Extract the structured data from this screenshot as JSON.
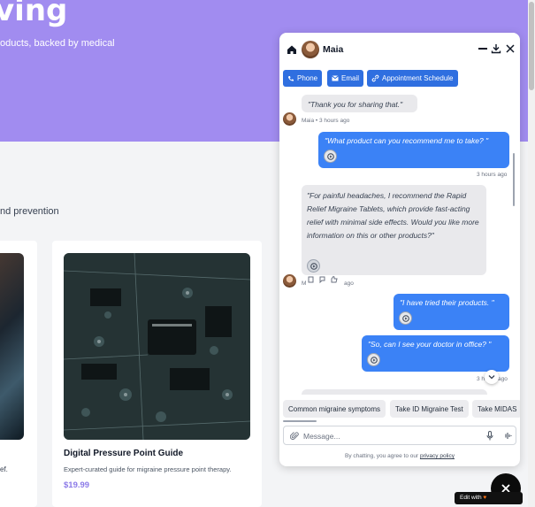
{
  "page": {
    "hero_title": "ving",
    "hero_subtitle": "oducts, backed by medical",
    "section_text": "nd prevention",
    "left_card_text": "ef.",
    "product_card": {
      "title": "Digital Pressure Point Guide",
      "description": "Expert-curated guide for migraine pressure point therapy.",
      "price": "$19.99"
    },
    "edit_badge": "Edit with"
  },
  "chat": {
    "agent_name": "Maia",
    "contact_buttons": [
      "Phone",
      "Email",
      "Appointment Schedule"
    ],
    "messages": [
      {
        "from": "agent",
        "text": "\"Thank you for sharing that.\""
      },
      {
        "meta": "Maia • 3 hours ago"
      },
      {
        "from": "user",
        "text": "\"What product can you recommend me to take? \""
      },
      {
        "meta": "3 hours ago"
      },
      {
        "from": "agent",
        "text": "\"For painful headaches, I recommend the Rapid Relief Migraine Tablets, which provide fast-acting relief with minimal side effects. Would you like more information on this or other products?\""
      },
      {
        "meta": "M",
        "meta_tail": "ago"
      },
      {
        "from": "user",
        "text": "\"I have tried their products. \""
      },
      {
        "from": "user",
        "text": "\"So, can I see your doctor in office? \""
      },
      {
        "meta": "3 h",
        "meta_tail": "ago"
      }
    ],
    "suggestions": [
      "Common migraine symptoms",
      "Take ID Migraine Test",
      "Take MIDAS"
    ],
    "input_placeholder": "Message...",
    "footer_prefix": "By chatting, you agree to our",
    "footer_link": "privacy policy",
    "colors": {
      "accent": "#3b82f6",
      "button": "#2f6fe0",
      "hero": "#a18cf0",
      "price": "#8b7ae8"
    }
  }
}
